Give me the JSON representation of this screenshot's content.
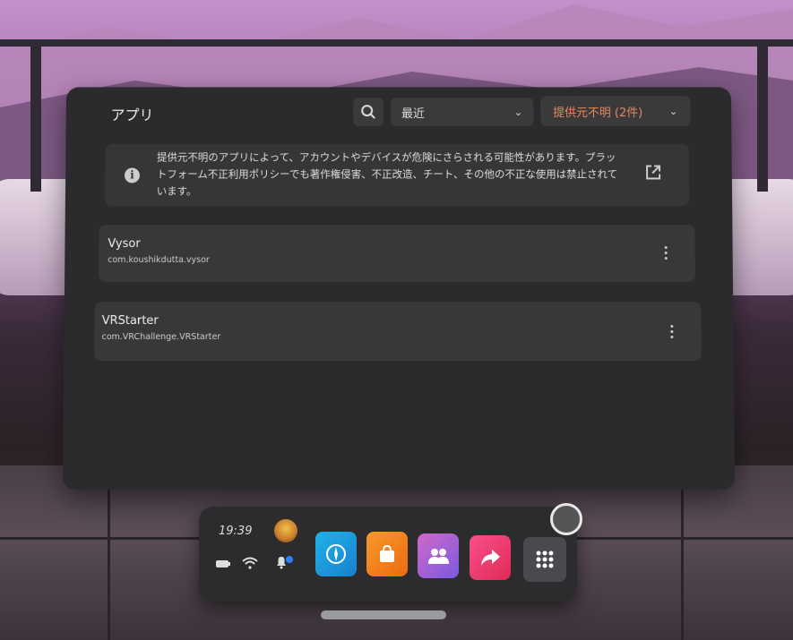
{
  "colors": {
    "accent": "#e88a5a",
    "panel": "#2b2b2d",
    "row": "#38383a"
  },
  "header": {
    "title": "アプリ",
    "sort_value": "最近",
    "source_filter": "提供元不明 (2件)"
  },
  "warning": {
    "text": "提供元不明のアプリによって、アカウントやデバイスが危険にさらされる可能性があります。プラットフォーム不正利用ポリシーでも著作権侵害、不正改造、チート、その他の不正な使用は禁止されています。"
  },
  "apps": [
    {
      "name": "Vysor",
      "package": "com.koushikdutta.vysor"
    },
    {
      "name": "VRStarter",
      "package": "com.VRChallenge.VRStarter"
    }
  ],
  "dock": {
    "time": "19:39",
    "apps": [
      {
        "icon": "explore-icon",
        "color": "#1a9fe0"
      },
      {
        "icon": "store-icon",
        "color": "#f07a1a"
      },
      {
        "icon": "people-icon",
        "color": "#b060d0"
      },
      {
        "icon": "share-icon",
        "color": "#f03a70"
      },
      {
        "icon": "app-grid-icon",
        "color": "#4a4a4e"
      }
    ]
  }
}
